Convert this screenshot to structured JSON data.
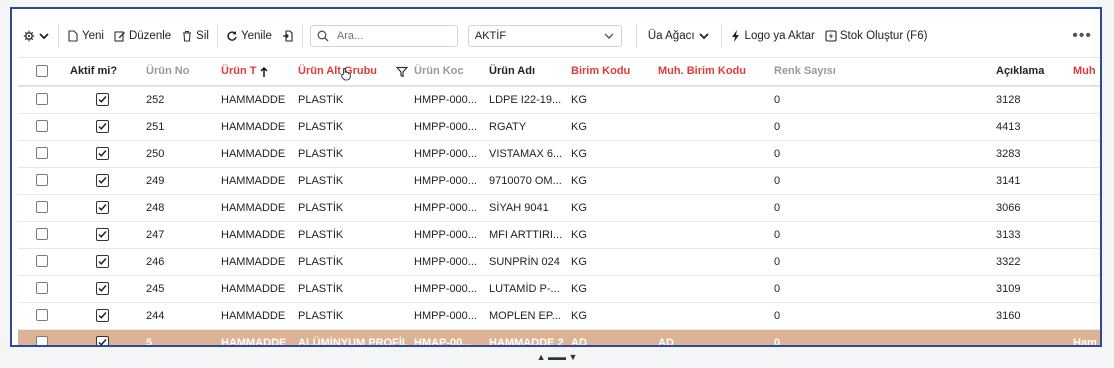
{
  "toolbar": {
    "new_label": "Yeni",
    "edit_label": "Düzenle",
    "delete_label": "Sil",
    "refresh_label": "Yenile",
    "search_placeholder": "Ara...",
    "status_value": "AKTİF",
    "tree_label": "Üa Ağacı",
    "logo_transfer_label": "Logo ya Aktar",
    "create_stock_label": "Stok Oluştur (F6)"
  },
  "columns": {
    "active": "Aktif mi?",
    "no": "Ürün  No",
    "type": "Ürün T",
    "subgroup": "Ürün Alt Grubu",
    "code": "Ürün Koc",
    "name": "Ürün Adı",
    "unit_code": "Birim Kodu",
    "acc_unit_code": "Muh. Birim Kodu",
    "color_count": "Renk Sayısı",
    "description": "Açıklama",
    "next": "Muh"
  },
  "rows": [
    {
      "no": "252",
      "type": "HAMMADDE",
      "subgroup": "PLASTİK",
      "code": "HMPP-000...",
      "name": "LDPE I22-19...",
      "unit": "KG",
      "acc_unit": "",
      "colors": "0",
      "desc": "3128",
      "extra": ""
    },
    {
      "no": "251",
      "type": "HAMMADDE",
      "subgroup": "PLASTİK",
      "code": "HMPP-000...",
      "name": "RGATY",
      "unit": "KG",
      "acc_unit": "",
      "colors": "0",
      "desc": "4413",
      "extra": ""
    },
    {
      "no": "250",
      "type": "HAMMADDE",
      "subgroup": "PLASTİK",
      "code": "HMPP-000...",
      "name": "VISTAMAX 6...",
      "unit": "KG",
      "acc_unit": "",
      "colors": "0",
      "desc": "3283",
      "extra": ""
    },
    {
      "no": "249",
      "type": "HAMMADDE",
      "subgroup": "PLASTİK",
      "code": "HMPP-000...",
      "name": "9710070 OM...",
      "unit": "KG",
      "acc_unit": "",
      "colors": "0",
      "desc": "3141",
      "extra": ""
    },
    {
      "no": "248",
      "type": "HAMMADDE",
      "subgroup": "PLASTİK",
      "code": "HMPP-000...",
      "name": "SİYAH 9041",
      "unit": "KG",
      "acc_unit": "",
      "colors": "0",
      "desc": "3066",
      "extra": ""
    },
    {
      "no": "247",
      "type": "HAMMADDE",
      "subgroup": "PLASTİK",
      "code": "HMPP-000...",
      "name": "MFI ARTTIRI...",
      "unit": "KG",
      "acc_unit": "",
      "colors": "0",
      "desc": "3133",
      "extra": ""
    },
    {
      "no": "246",
      "type": "HAMMADDE",
      "subgroup": "PLASTİK",
      "code": "HMPP-000...",
      "name": "SUNPRİN 024",
      "unit": "KG",
      "acc_unit": "",
      "colors": "0",
      "desc": "3322",
      "extra": ""
    },
    {
      "no": "245",
      "type": "HAMMADDE",
      "subgroup": "PLASTİK",
      "code": "HMPP-000...",
      "name": "LUTAMİD P-...",
      "unit": "KG",
      "acc_unit": "",
      "colors": "0",
      "desc": "3109",
      "extra": ""
    },
    {
      "no": "244",
      "type": "HAMMADDE",
      "subgroup": "PLASTİK",
      "code": "HMPP-000...",
      "name": "MOPLEN EP...",
      "unit": "KG",
      "acc_unit": "",
      "colors": "0",
      "desc": "3160",
      "extra": ""
    },
    {
      "no": "5",
      "type": "HAMMADDE",
      "subgroup": "ALÜMİNYUM PROFİL",
      "code": "HMAP-00...",
      "name": "HAMMADDE 2",
      "unit": "AD",
      "acc_unit": "AD",
      "colors": "0",
      "desc": "",
      "extra": "Ham"
    }
  ],
  "colors": {
    "border": "#2b4a9c",
    "required_header": "#e03a3a",
    "selected_row": "#dcb394"
  },
  "icons": [
    "gear-icon",
    "chevron-down-icon",
    "file-icon",
    "edit-icon",
    "trash-icon",
    "refresh-icon",
    "export-icon",
    "search-icon",
    "tree-icon",
    "bolt-icon",
    "stock-icon",
    "more-icon",
    "sort-up-icon",
    "filter-icon",
    "hand-cursor-icon"
  ]
}
